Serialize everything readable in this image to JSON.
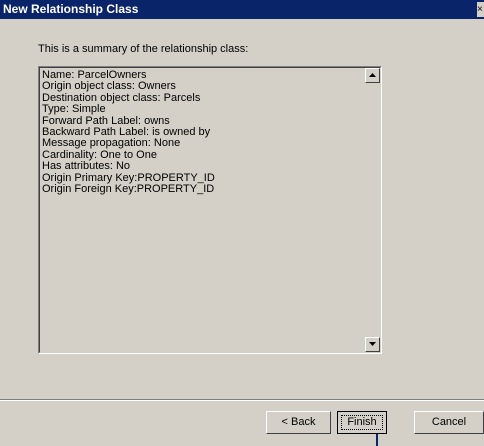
{
  "window": {
    "title": "New Relationship Class",
    "close_glyph": "×"
  },
  "summary": {
    "intro": "This is a summary of the relationship class:",
    "lines": [
      "Name: ParcelOwners",
      "Origin object class: Owners",
      "Destination object class: Parcels",
      "Type: Simple",
      "Forward Path Label: owns",
      "Backward Path Label: is owned by",
      "Message propagation: None",
      "Cardinality: One to One",
      "Has attributes: No",
      "Origin Primary Key:PROPERTY_ID",
      "Origin Foreign Key:PROPERTY_ID"
    ]
  },
  "buttons": {
    "back": "< Back",
    "finish": "Finish",
    "cancel": "Cancel"
  },
  "colors": {
    "titlebar": "#0a246a",
    "dialog_face": "#d4d0c8"
  }
}
